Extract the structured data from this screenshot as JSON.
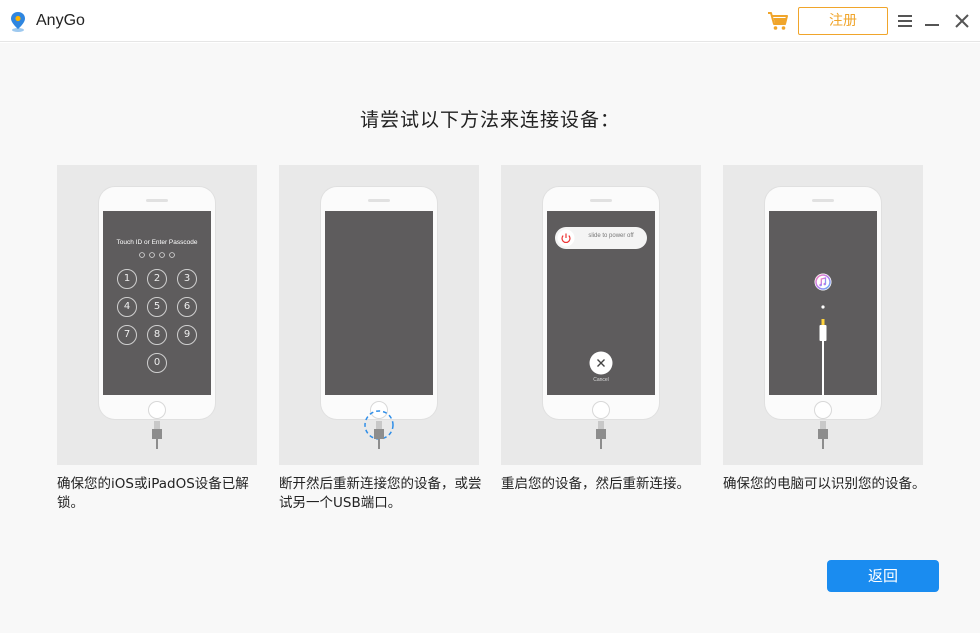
{
  "app": {
    "title": "AnyGo"
  },
  "toolbar": {
    "register_label": "注册"
  },
  "main": {
    "heading": "请尝试以下方法来连接设备：",
    "cards": [
      {
        "text": "确保您的iOS或iPadOS设备已解锁。",
        "screen_caption": "Touch ID or Enter Passcode",
        "keys": [
          "1",
          "2",
          "3",
          "4",
          "5",
          "6",
          "7",
          "8",
          "9",
          "0"
        ]
      },
      {
        "text": "断开然后重新连接您的设备，或尝试另一个USB端口。"
      },
      {
        "text": "重启您的设备，然后重新连接。",
        "slider_text": "slide to power off",
        "cancel_text": "Cancel"
      },
      {
        "text": "确保您的电脑可以识别您的设备。"
      }
    ],
    "back_label": "返回"
  },
  "colors": {
    "accent": "#1a8cf0",
    "brand_orange": "#f0a52b"
  }
}
